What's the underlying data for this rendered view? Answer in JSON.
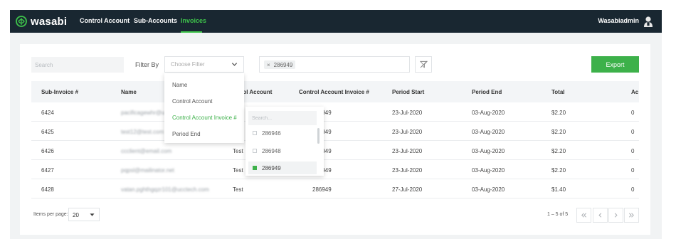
{
  "nav": {
    "brand": "wasabi",
    "items": [
      "Control Account",
      "Sub-Accounts",
      "Invoices"
    ],
    "active_item": "Invoices",
    "user": "Wasabiadmin"
  },
  "toolbar": {
    "search_placeholder": "Search",
    "filter_label": "Filter By",
    "filter_placeholder": "Choose Filter",
    "chip_value": "286949",
    "export_label": "Export"
  },
  "filter_menu": {
    "items": [
      "Name",
      "Control Account",
      "Control Account Invoice #",
      "Period End"
    ],
    "active_item": "Control Account Invoice #"
  },
  "value_panel": {
    "search_placeholder": "Search...",
    "options": [
      "286946",
      "286948",
      "286949"
    ],
    "selected": "286949"
  },
  "table": {
    "headers": [
      "Sub-Invoice #",
      "Name",
      "Control Account",
      "Control Account Invoice #",
      "Period Start",
      "Period End",
      "Total",
      "Ac"
    ],
    "rows": [
      [
        "6424",
        "pacificagewhr@ucctech.com",
        "",
        "286949",
        "23-Jul-2020",
        "03-Aug-2020",
        "$2.20",
        "0"
      ],
      [
        "6425",
        "test12@test.com",
        "",
        "286949",
        "23-Jul-2020",
        "03-Aug-2020",
        "$2.20",
        "0"
      ],
      [
        "6426",
        "ccclient@email.com",
        "Test",
        "286949",
        "23-Jul-2020",
        "03-Aug-2020",
        "$2.20",
        "0"
      ],
      [
        "6427",
        "pqpsl@mailinator.net",
        "Test",
        "286949",
        "23-Jul-2020",
        "03-Aug-2020",
        "$2.20",
        "0"
      ],
      [
        "6428",
        "vatan.pghthgqzr101@ucctech.com",
        "Test",
        "286949",
        "27-Jul-2020",
        "03-Aug-2020",
        "$1.40",
        "0"
      ]
    ]
  },
  "pagination": {
    "items_per_page_label": "Items per page:",
    "items_per_page": "20",
    "range": "1 – 5 of 5"
  },
  "colors": {
    "nav_bg": "#192731",
    "accent": "#3db14a",
    "page_bg": "#f1f3f4"
  }
}
